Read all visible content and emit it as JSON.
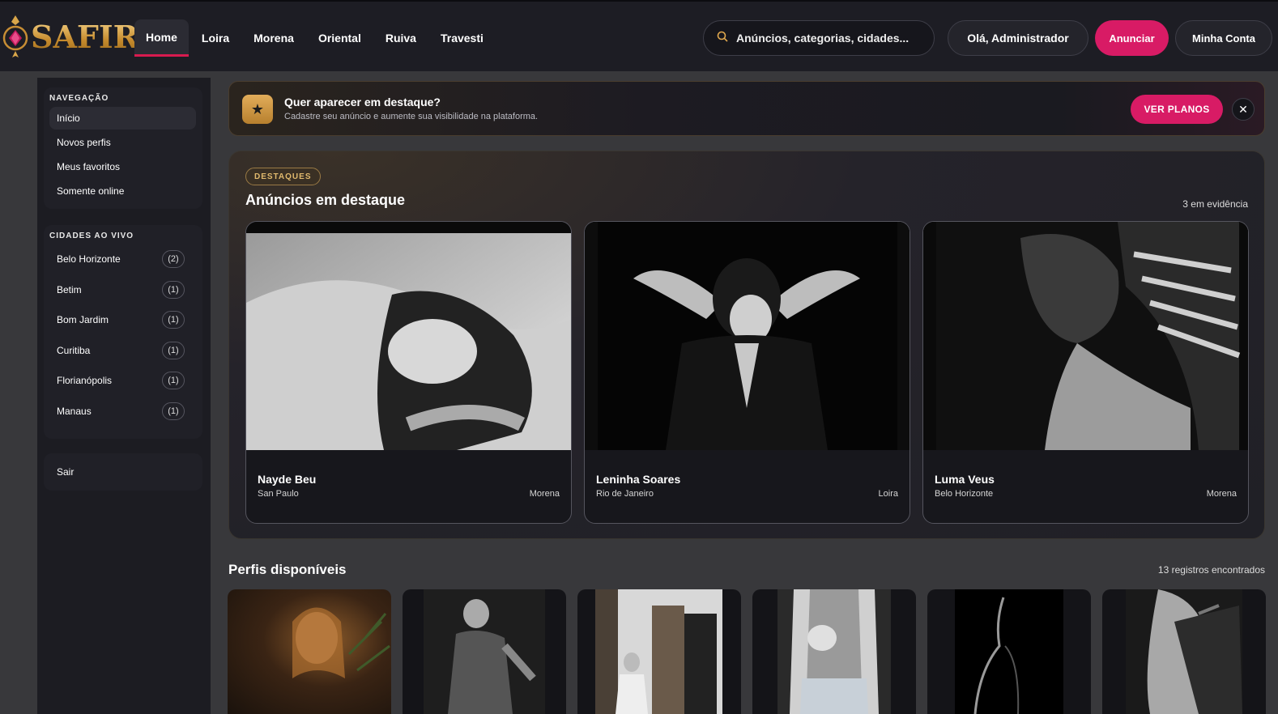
{
  "brand": {
    "name": "SAFIRA",
    "accent": "#d81b65",
    "gold": "#d9a64a"
  },
  "nav": {
    "items": [
      {
        "label": "Home",
        "active": true
      },
      {
        "label": "Loira"
      },
      {
        "label": "Morena"
      },
      {
        "label": "Oriental"
      },
      {
        "label": "Ruiva"
      },
      {
        "label": "Travesti"
      }
    ]
  },
  "search": {
    "placeholder": "Anúncios, categorias, cidades..."
  },
  "header": {
    "greeting": "Olá, Administrador",
    "announce_label": "Anunciar",
    "account_label": "Minha Conta"
  },
  "sidebar": {
    "nav_heading": "NAVEGAÇÃO",
    "nav_items": [
      "Início",
      "Novos perfis",
      "Meus favoritos",
      "Somente online"
    ],
    "cities_heading": "CIDADES AO VIVO",
    "cities": [
      {
        "name": "Belo Horizonte",
        "count": "(2)"
      },
      {
        "name": "Betim",
        "count": "(1)"
      },
      {
        "name": "Bom Jardim",
        "count": "(1)"
      },
      {
        "name": "Curitiba",
        "count": "(1)"
      },
      {
        "name": "Florianópolis",
        "count": "(1)"
      },
      {
        "name": "Manaus",
        "count": "(1)"
      }
    ],
    "logout": "Sair"
  },
  "banner": {
    "title": "Quer aparecer em destaque?",
    "subtitle": "Cadastre seu anúncio e aumente sua visibilidade na plataforma.",
    "button": "VER PLANOS",
    "close": "✕"
  },
  "featured": {
    "tag": "DESTAQUES",
    "title": "Anúncios em destaque",
    "count": "3 em evidência",
    "cards": [
      {
        "name": "Nayde Beu",
        "city": "San Paulo",
        "category": "Morena"
      },
      {
        "name": "Leninha Soares",
        "city": "Rio de Janeiro",
        "category": "Loira"
      },
      {
        "name": "Luma Veus",
        "city": "Belo Horizonte",
        "category": "Morena"
      }
    ]
  },
  "profiles": {
    "title": "Perfis disponíveis",
    "count": "13 registros encontrados"
  }
}
